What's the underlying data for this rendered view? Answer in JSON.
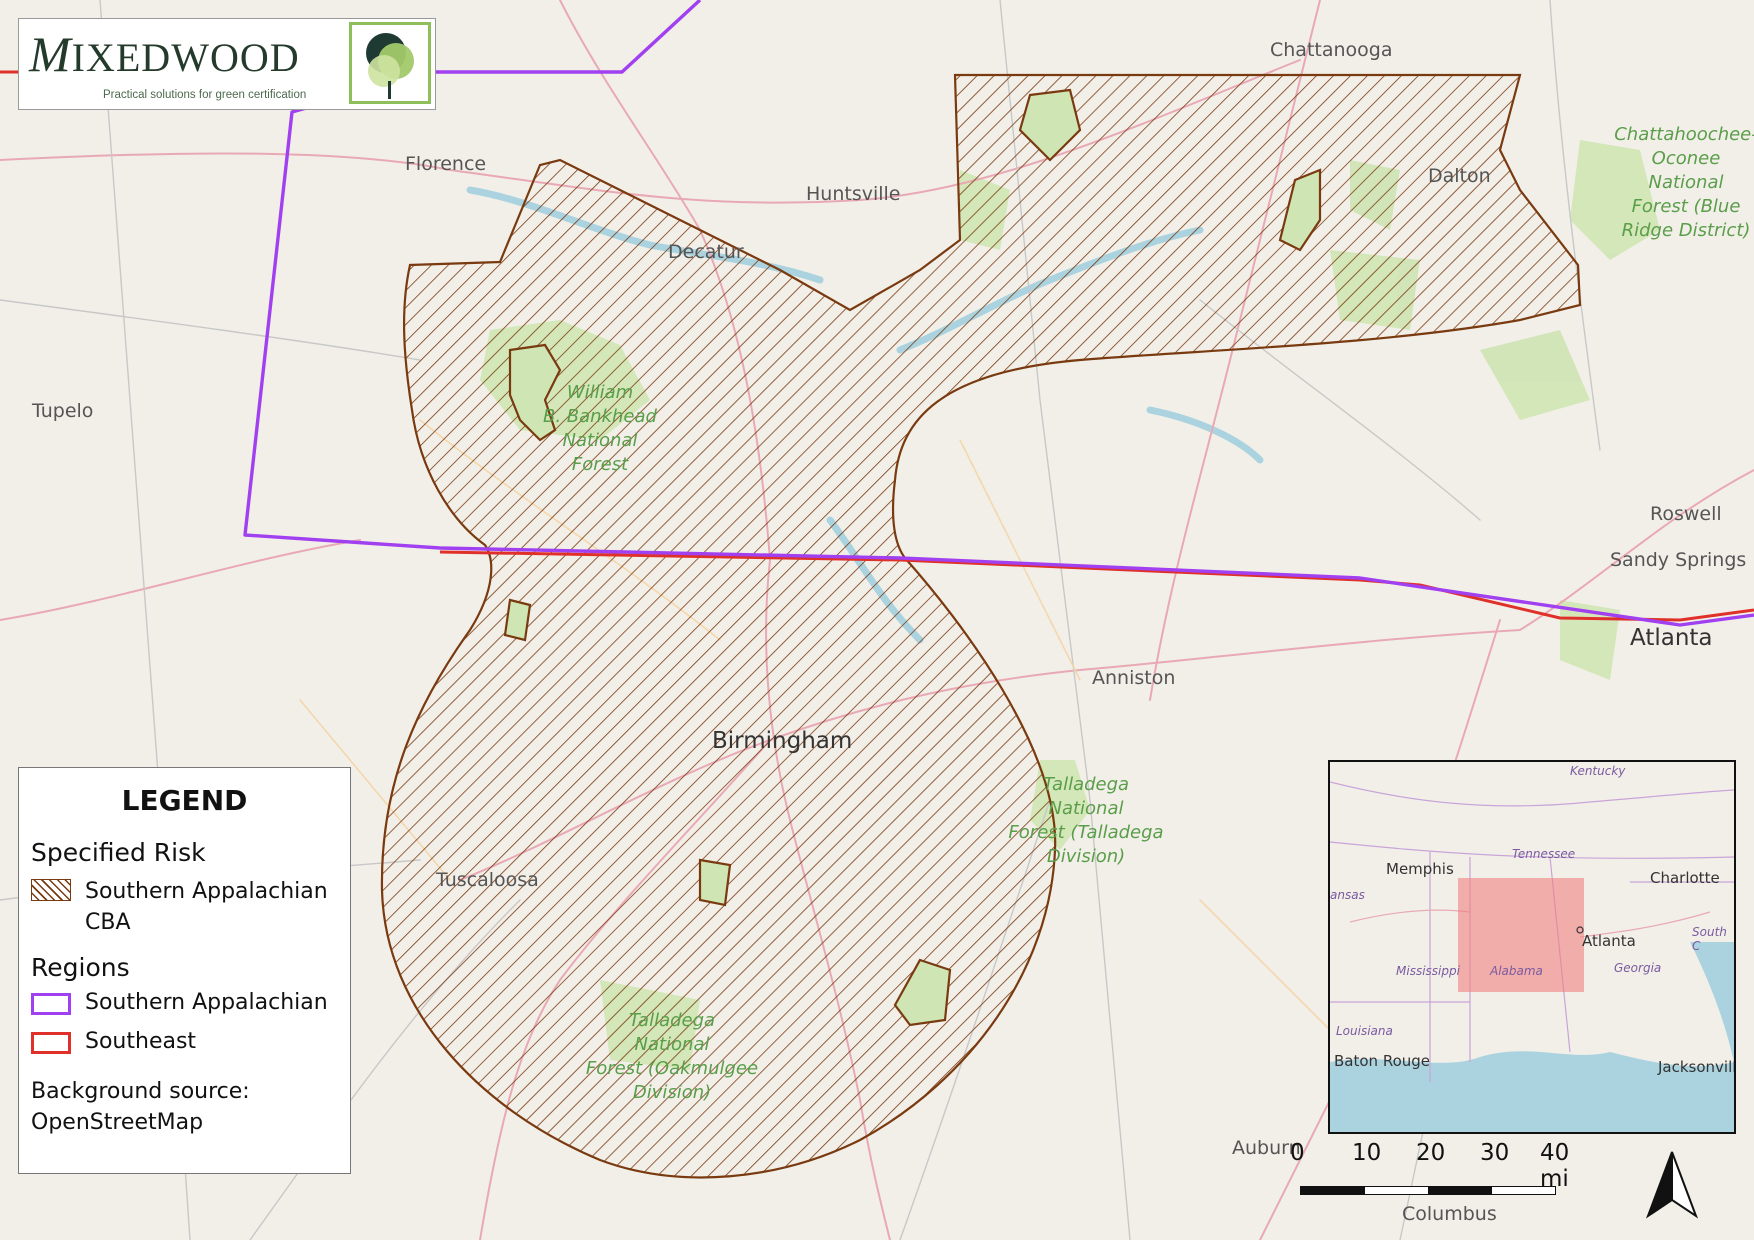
{
  "logo": {
    "name_first": "M",
    "name_rest": "IXED",
    "name_second": "WOOD",
    "tagline": "Practical solutions for green certification"
  },
  "cities": {
    "chattanooga": "Chattanooga",
    "florence": "Florence",
    "huntsville": "Huntsville",
    "decatur": "Decatur",
    "dalton": "Dalton",
    "tupelo": "Tupelo",
    "roswell": "Roswell",
    "sandy_springs": "Sandy Springs",
    "atlanta": "Atlanta",
    "anniston": "Anniston",
    "birmingham": "Birmingham",
    "tuscaloosa": "Tuscaloosa",
    "auburn": "Auburn",
    "columbus": "Columbus"
  },
  "forests": {
    "bankhead": [
      "William",
      "B. Bankhead",
      "National",
      "Forest"
    ],
    "talladega": [
      "Talladega",
      "National",
      "Forest (Talladega",
      "Division)"
    ],
    "oakmulgee": [
      "Talladega",
      "National",
      "Forest (Oakmulgee",
      "Division)"
    ],
    "chattahoochee": [
      "Chattahoochee-",
      "Oconee",
      "National",
      "Forest (Blue",
      "Ridge District)"
    ]
  },
  "legend": {
    "title": "LEGEND",
    "specified_risk_heading": "Specified Risk",
    "cba_label_line1": "Southern Appalachian",
    "cba_label_line2": "CBA",
    "regions_heading": "Regions",
    "region_southern_appalachian": "Southern Appalachian",
    "region_southeast": "Southeast",
    "source_line1": "Background source:",
    "source_line2": "OpenStreetMap"
  },
  "inset": {
    "kentucky": "Kentucky",
    "tennessee": "Tennessee",
    "memphis": "Memphis",
    "charlotte": "Charlotte",
    "arkansas": "ansas",
    "atlanta": "Atlanta",
    "south_c": "South C",
    "mississippi": "Mississippi",
    "alabama": "Alabama",
    "georgia": "Georgia",
    "louisiana": "Louisiana",
    "baton_rouge": "Baton Rouge",
    "jacksonville": "Jacksonvill"
  },
  "scalebar": {
    "ticks": [
      "0",
      "10",
      "20",
      "30",
      "40 mi"
    ]
  },
  "colors": {
    "cba_outline": "#7a3a10",
    "southern_appalachian_region": "#a040f0",
    "southeast_region": "#e0302a",
    "forest_green": "#5a9e4a",
    "inset_extent": "#f08080"
  }
}
